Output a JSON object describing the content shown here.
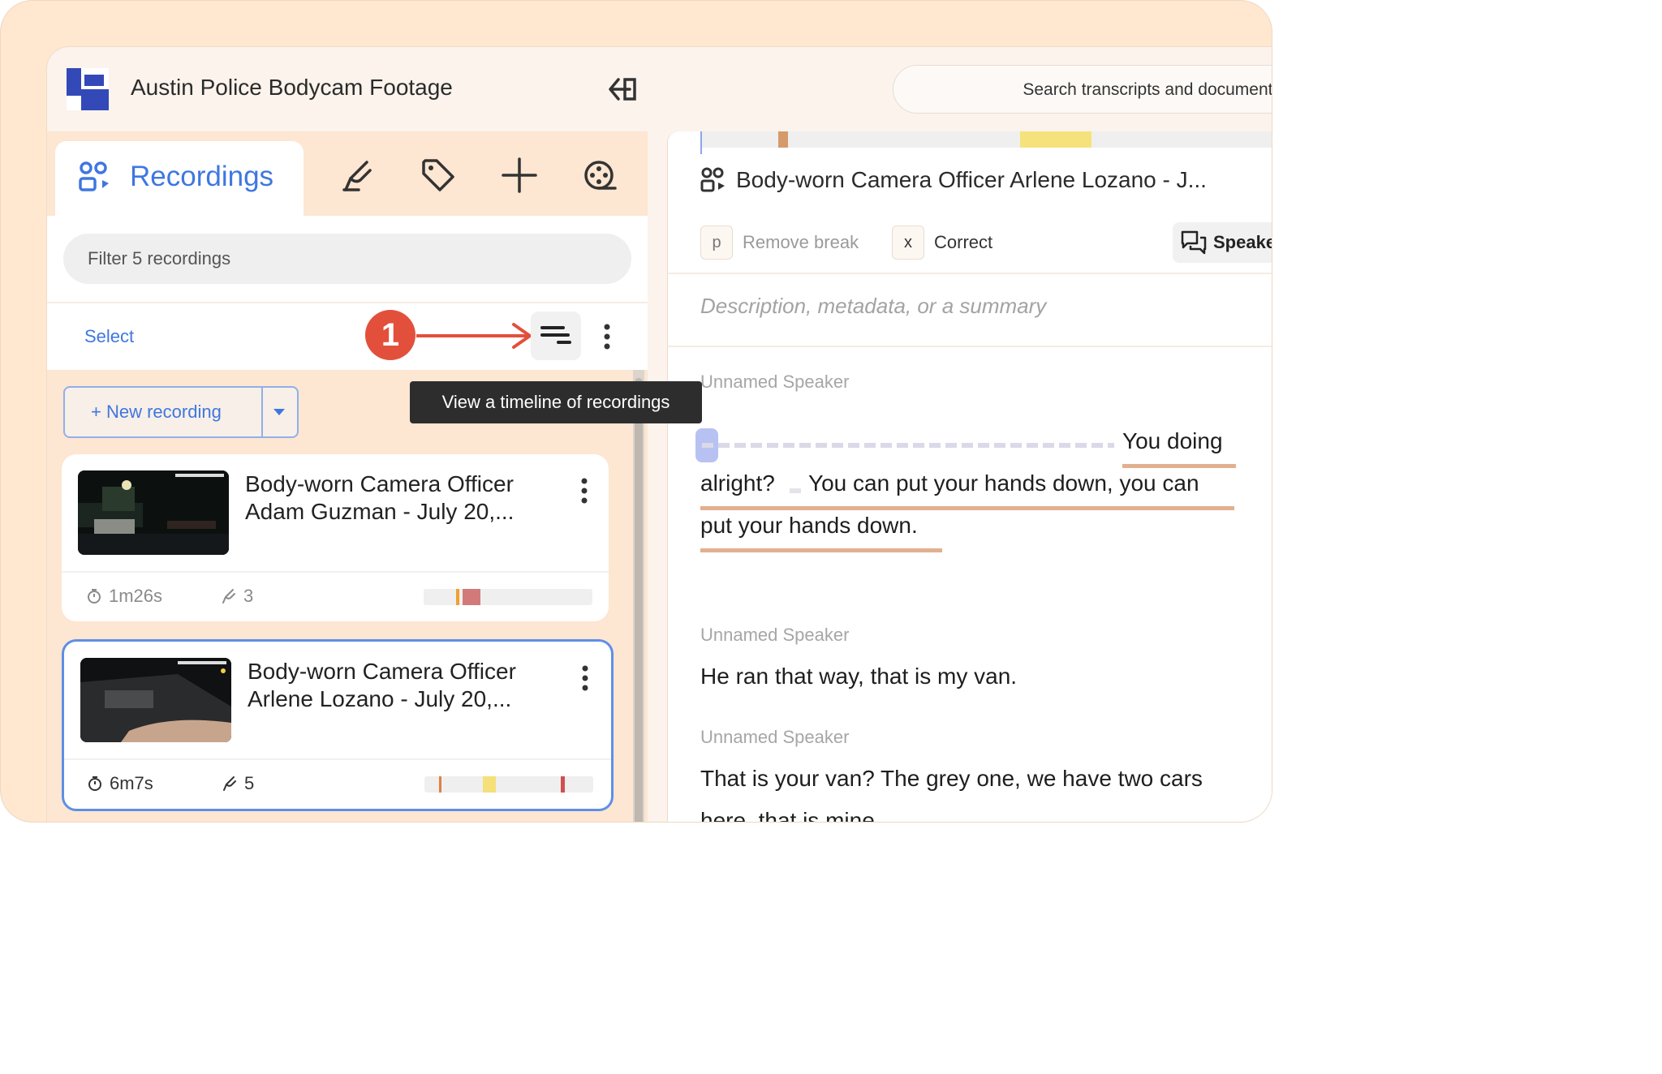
{
  "header": {
    "app_title": "Austin Police Bodycam Footage",
    "search_placeholder": "Search transcripts and documents"
  },
  "left_panel": {
    "tabs": [
      {
        "label": "Recordings",
        "icon": "people-icon",
        "active": true
      },
      {
        "label": "",
        "icon": "highlighter-icon"
      },
      {
        "label": "",
        "icon": "tag-icon"
      },
      {
        "label": "",
        "icon": "plus-icon"
      },
      {
        "label": "",
        "icon": "reel-icon"
      }
    ],
    "filter_placeholder": "Filter 5 recordings",
    "select_label": "Select",
    "annotation_number": "1",
    "tooltip": "View a timeline of recordings",
    "new_recording_label": "+ New recording",
    "recordings": [
      {
        "title": "Body-worn Camera Officer Adam Guzman - July 20,...",
        "duration": "1m26s",
        "highlights": "3",
        "selected": false
      },
      {
        "title": "Body-worn Camera Officer Arlene Lozano - July 20,...",
        "duration": "6m7s",
        "highlights": "5",
        "selected": true
      }
    ]
  },
  "right_panel": {
    "title": "Body-worn Camera Officer Arlene Lozano - J...",
    "shortcuts": [
      {
        "key": "p",
        "label": "Remove break"
      },
      {
        "key": "x",
        "label": "Correct"
      }
    ],
    "speaker_button": "Speake",
    "description_placeholder": "Description, metadata, or a summary",
    "transcript": [
      {
        "speaker": "Unnamed Speaker",
        "lines": [
          "You doing",
          "alright?",
          "You can put your hands down, you can",
          "put your hands down."
        ]
      },
      {
        "speaker": "Unnamed Speaker",
        "lines": [
          "He ran that way, that is my van."
        ]
      },
      {
        "speaker": "Unnamed Speaker",
        "lines": [
          "That is your van? The grey one, we have two cars",
          "here, that is mine."
        ]
      }
    ]
  },
  "colors": {
    "frame_bg": "#ffe7d0",
    "accent_blue": "#3f77e0",
    "annotation_red": "#e2503c",
    "highlight_underline": "#e2b08f",
    "tooltip_bg": "#2d2d2d"
  }
}
